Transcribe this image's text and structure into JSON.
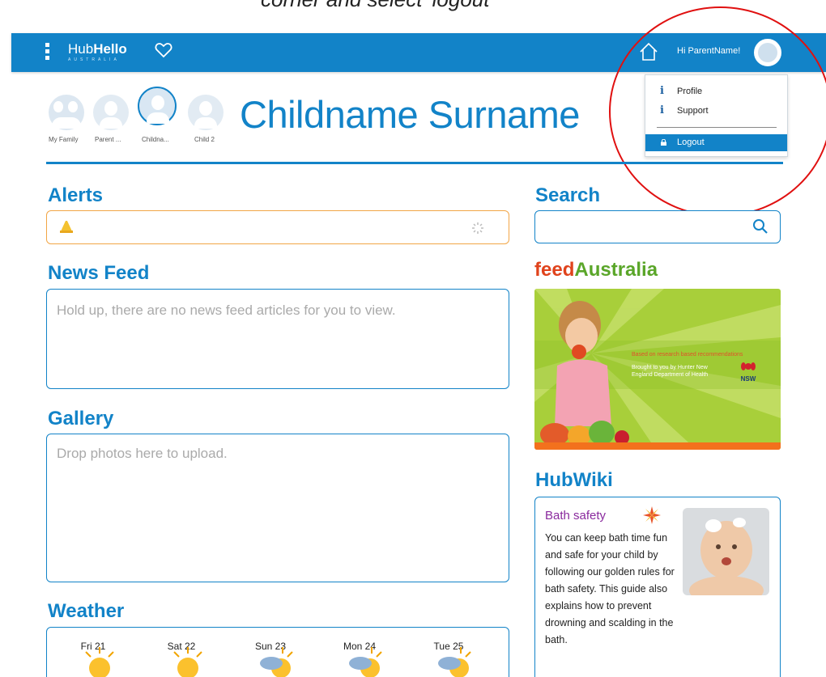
{
  "caption": "corner and select 'logout'",
  "topbar": {
    "logo_main": "Hub",
    "logo_bold": "Hello",
    "logo_sub": "AUSTRALIA",
    "greeting": "Hi ParentName!",
    "bar_color": "#1283c8"
  },
  "user_menu": {
    "items": [
      {
        "label": "Profile",
        "icon": "info-icon"
      },
      {
        "label": "Support",
        "icon": "info-icon"
      }
    ],
    "logout_label": "Logout"
  },
  "family": {
    "members": [
      {
        "label": "My Family"
      },
      {
        "label": "Parent ..."
      },
      {
        "label": "Childna..."
      },
      {
        "label": "Child 2"
      }
    ],
    "selected_name": "Childname Surname"
  },
  "alerts": {
    "title": "Alerts"
  },
  "news_feed": {
    "title": "News Feed",
    "empty_text": "Hold up, there are no news feed articles for you to view."
  },
  "gallery": {
    "title": "Gallery",
    "drop_text": "Drop photos here to upload."
  },
  "weather": {
    "title": "Weather",
    "days": [
      {
        "label": "Fri 21",
        "icon": "sunny-icon"
      },
      {
        "label": "Sat 22",
        "icon": "sunny-icon"
      },
      {
        "label": "Sun 23",
        "icon": "partly-cloudy-icon"
      },
      {
        "label": "Mon 24",
        "icon": "partly-cloudy-icon"
      },
      {
        "label": "Tue 25",
        "icon": "partly-cloudy-icon"
      }
    ]
  },
  "search": {
    "title": "Search",
    "value": ""
  },
  "feed_australia": {
    "logo_part1": "feed",
    "logo_part2": "Australia",
    "banner_line1": "Based on research based recommendations",
    "banner_line2": "Brought to you by Hunter New England Department of Health",
    "badge": "NSW"
  },
  "hubwiki": {
    "title": "HubWiki",
    "article_title": "Bath safety",
    "article_text": "You can keep bath time fun and safe for your child by following our golden rules for bath safety. This guide also explains how to prevent drowning and scalding in the bath."
  }
}
